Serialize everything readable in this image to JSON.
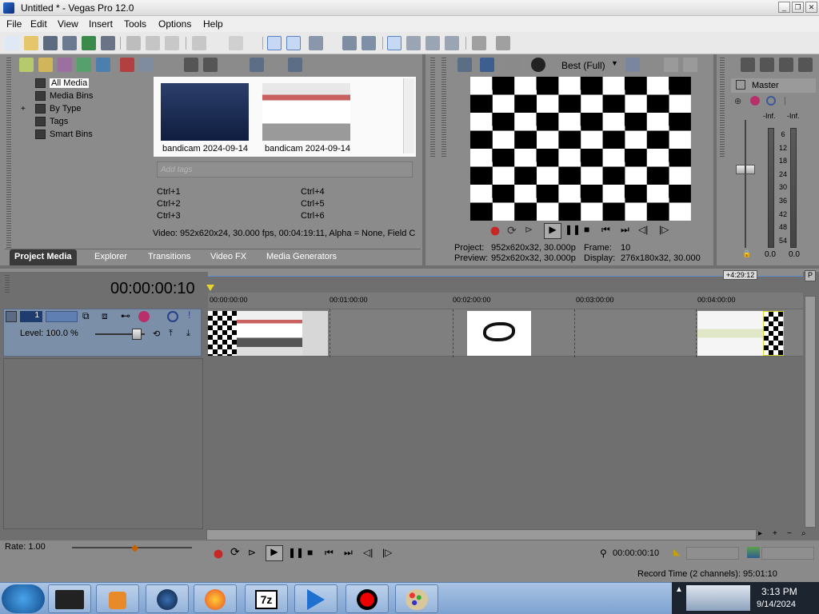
{
  "window": {
    "title": "Untitled * - Vegas Pro 12.0"
  },
  "menu": [
    "File",
    "Edit",
    "View",
    "Insert",
    "Tools",
    "Options",
    "Help"
  ],
  "explorer": {
    "tree": [
      "All Media",
      "Media Bins",
      "By Type",
      "Tags",
      "Smart Bins"
    ],
    "thumbnails": [
      {
        "caption": "bandicam 2024-09-14"
      },
      {
        "caption": "bandicam 2024-09-14"
      }
    ],
    "tag_placeholder": "Add tags",
    "shortcuts": [
      "Ctrl+1",
      "Ctrl+2",
      "Ctrl+3",
      "Ctrl+4",
      "Ctrl+5",
      "Ctrl+6"
    ],
    "media_info": "Video: 952x620x24, 30.000 fps, 00:04:19:11, Alpha = None, Field C"
  },
  "tabs": [
    "Project Media",
    "Explorer",
    "Transitions",
    "Video FX",
    "Media Generators"
  ],
  "preview": {
    "quality": "Best (Full)",
    "project_label": "Project:",
    "project_value": "952x620x32, 30.000p",
    "frame_label": "Frame:",
    "frame_value": "10",
    "preview_label": "Preview:",
    "preview_value": "952x620x32, 30.000p",
    "display_label": "Display:",
    "display_value": "276x180x32, 30.000"
  },
  "mixer": {
    "master_label": "Master",
    "left_inf": "-Inf.",
    "right_inf": "-Inf.",
    "scale": [
      "6",
      "12",
      "18",
      "24",
      "30",
      "36",
      "42",
      "48",
      "54"
    ],
    "left_value": "0.0",
    "right_value": "0.0"
  },
  "timeline": {
    "timecode": "00:00:00:10",
    "end_marker": "+4:29:12",
    "ruler": [
      "00:00:00:00",
      "00:01:00:00",
      "00:02:00:00",
      "00:03:00:00",
      "00:04:00:00"
    ],
    "track_number": "1",
    "level": "Level: 100.0 %"
  },
  "bottom": {
    "rate": "Rate: 1.00",
    "cursor_time": "00:00:00:10",
    "record_time": "Record Time (2 channels): 95:01:10"
  },
  "taskbar": {
    "time": "3:13 PM",
    "date": "9/14/2024"
  }
}
